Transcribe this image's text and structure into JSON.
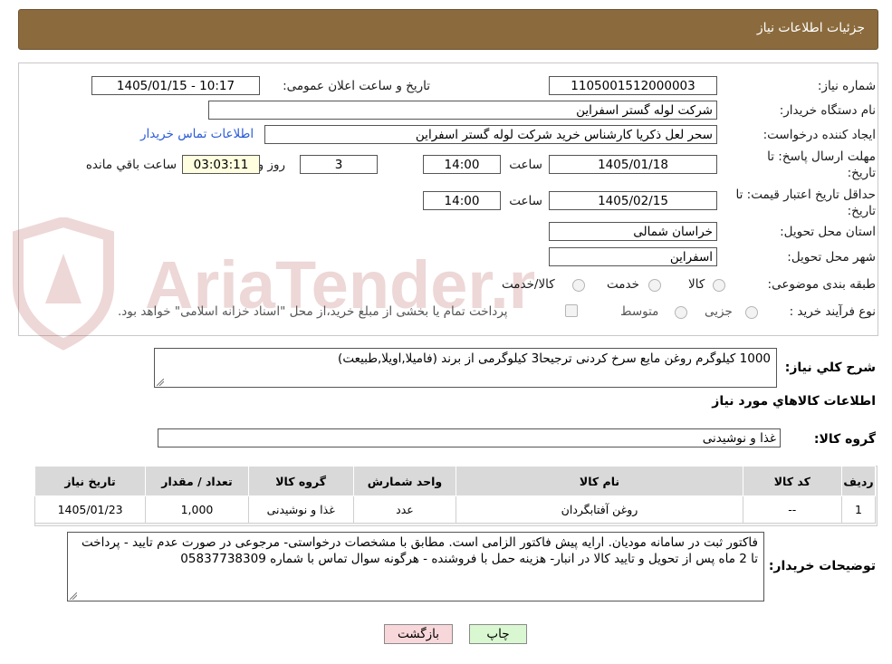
{
  "header": {
    "title": "جزئیات اطلاعات نیاز"
  },
  "fields": {
    "need_number_label": "شماره نیاز:",
    "need_number": "1105001512000003",
    "announce_label": "تاریخ و ساعت اعلان عمومی:",
    "announce_value": "1405/01/15 - 10:17",
    "buyer_org_label": "نام دستگاه خریدار:",
    "buyer_org": "شرکت لوله گستر اسفراین",
    "creator_label": "ایجاد کننده درخواست:",
    "creator": "سحر لعل ذکریا کارشناس خرید شرکت لوله گستر اسفراین",
    "contact_link": "اطلاعات تماس خریدار",
    "deadline_label_1": "مهلت ارسال پاسخ: تا",
    "deadline_label_2": "تاریخ:",
    "deadline_date": "1405/01/18",
    "time_label": "ساعت",
    "deadline_time": "14:00",
    "days_value": "3",
    "days_label": "روز و",
    "remaining_time": "03:03:11",
    "remaining_label": "ساعت باقي مانده",
    "validity_label_1": "حداقل تاریخ اعتبار قیمت: تا",
    "validity_label_2": "تاریخ:",
    "validity_date": "1405/02/15",
    "validity_time": "14:00",
    "province_label": "استان محل تحویل:",
    "province": "خراسان شمالی",
    "city_label": "شهر محل تحویل:",
    "city": "اسفراین",
    "category_label": "طبقه بندی موضوعی:",
    "category_options": [
      "کالا",
      "خدمت",
      "کالا/خدمت"
    ],
    "process_label": "نوع فرآیند خرید :",
    "process_options": [
      "جزیی",
      "متوسط"
    ],
    "payment_note": "پرداخت تمام یا بخشی از مبلغ خرید،از محل \"اسناد خزانه اسلامی\" خواهد بود."
  },
  "description": {
    "label": "شرح کلي نياز:",
    "text": "1000 کیلوگرم روغن  مایع سرخ کردنی ترجیحا3 کیلوگرمی از برند (فامیلا,اویلا,طبیعت)"
  },
  "goods_info_title": "اطلاعات کالاهاي مورد نياز",
  "goods_group": {
    "label": "گروه کالا:",
    "value": "غذا و نوشیدنی"
  },
  "table": {
    "headers": [
      "رديف",
      "کد کالا",
      "نام کالا",
      "واحد شمارش",
      "گروه کالا",
      "تعداد / مقدار",
      "تاريخ نياز"
    ],
    "rows": [
      [
        "1",
        "--",
        "روغن آفتابگردان",
        "عدد",
        "غذا و نوشیدنی",
        "1,000",
        "1405/01/23"
      ]
    ]
  },
  "buyer_notes": {
    "label": "توضیحات خریدار:",
    "text": "فاکتور ثبت در سامانه مودیان. ارایه پیش فاکتور الزامی است. مطابق با مشخصات درخواستی- مرجوعی در صورت عدم تایید - پرداخت تا 2 ماه پس از تحویل و تایید کالا در انبار- هزینه حمل با فروشنده - هرگونه سوال تماس با شماره 05837738309"
  },
  "buttons": {
    "print": "چاپ",
    "back": "بازگشت"
  },
  "watermark": {
    "text": "AriaTender.neT"
  },
  "colors": {
    "header_bg": "#8b6b3d",
    "back_button_bg": "#f8d7da",
    "print_button_bg": "#d9f7d0",
    "link": "#2a5bd7"
  }
}
